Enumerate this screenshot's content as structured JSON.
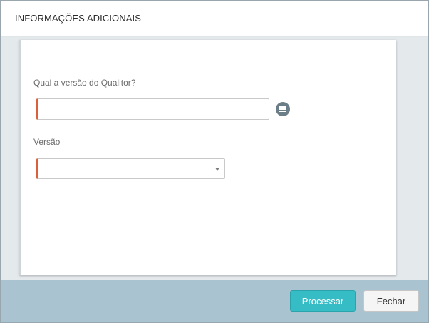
{
  "dialog": {
    "title": "INFORMAÇÕES ADICIONAIS"
  },
  "form": {
    "question_label": "Qual a versão do Qualitor?",
    "question_value": "",
    "question_icon": "list-icon",
    "version_label": "Versão",
    "version_selected": ""
  },
  "footer": {
    "process_label": "Processar",
    "close_label": "Fechar"
  },
  "colors": {
    "required_marker": "#d9603b",
    "primary_button": "#35bcc4",
    "footer_background": "#a9c4d0",
    "body_background": "#e4e9ec"
  }
}
